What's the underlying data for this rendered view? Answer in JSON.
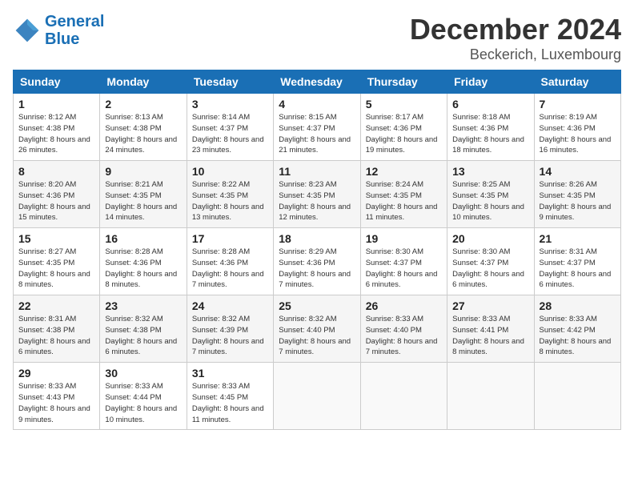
{
  "header": {
    "logo_line1": "General",
    "logo_line2": "Blue",
    "title": "December 2024",
    "subtitle": "Beckerich, Luxembourg"
  },
  "weekdays": [
    "Sunday",
    "Monday",
    "Tuesday",
    "Wednesday",
    "Thursday",
    "Friday",
    "Saturday"
  ],
  "weeks": [
    [
      {
        "day": "1",
        "sunrise": "Sunrise: 8:12 AM",
        "sunset": "Sunset: 4:38 PM",
        "daylight": "Daylight: 8 hours and 26 minutes."
      },
      {
        "day": "2",
        "sunrise": "Sunrise: 8:13 AM",
        "sunset": "Sunset: 4:38 PM",
        "daylight": "Daylight: 8 hours and 24 minutes."
      },
      {
        "day": "3",
        "sunrise": "Sunrise: 8:14 AM",
        "sunset": "Sunset: 4:37 PM",
        "daylight": "Daylight: 8 hours and 23 minutes."
      },
      {
        "day": "4",
        "sunrise": "Sunrise: 8:15 AM",
        "sunset": "Sunset: 4:37 PM",
        "daylight": "Daylight: 8 hours and 21 minutes."
      },
      {
        "day": "5",
        "sunrise": "Sunrise: 8:17 AM",
        "sunset": "Sunset: 4:36 PM",
        "daylight": "Daylight: 8 hours and 19 minutes."
      },
      {
        "day": "6",
        "sunrise": "Sunrise: 8:18 AM",
        "sunset": "Sunset: 4:36 PM",
        "daylight": "Daylight: 8 hours and 18 minutes."
      },
      {
        "day": "7",
        "sunrise": "Sunrise: 8:19 AM",
        "sunset": "Sunset: 4:36 PM",
        "daylight": "Daylight: 8 hours and 16 minutes."
      }
    ],
    [
      {
        "day": "8",
        "sunrise": "Sunrise: 8:20 AM",
        "sunset": "Sunset: 4:36 PM",
        "daylight": "Daylight: 8 hours and 15 minutes."
      },
      {
        "day": "9",
        "sunrise": "Sunrise: 8:21 AM",
        "sunset": "Sunset: 4:35 PM",
        "daylight": "Daylight: 8 hours and 14 minutes."
      },
      {
        "day": "10",
        "sunrise": "Sunrise: 8:22 AM",
        "sunset": "Sunset: 4:35 PM",
        "daylight": "Daylight: 8 hours and 13 minutes."
      },
      {
        "day": "11",
        "sunrise": "Sunrise: 8:23 AM",
        "sunset": "Sunset: 4:35 PM",
        "daylight": "Daylight: 8 hours and 12 minutes."
      },
      {
        "day": "12",
        "sunrise": "Sunrise: 8:24 AM",
        "sunset": "Sunset: 4:35 PM",
        "daylight": "Daylight: 8 hours and 11 minutes."
      },
      {
        "day": "13",
        "sunrise": "Sunrise: 8:25 AM",
        "sunset": "Sunset: 4:35 PM",
        "daylight": "Daylight: 8 hours and 10 minutes."
      },
      {
        "day": "14",
        "sunrise": "Sunrise: 8:26 AM",
        "sunset": "Sunset: 4:35 PM",
        "daylight": "Daylight: 8 hours and 9 minutes."
      }
    ],
    [
      {
        "day": "15",
        "sunrise": "Sunrise: 8:27 AM",
        "sunset": "Sunset: 4:35 PM",
        "daylight": "Daylight: 8 hours and 8 minutes."
      },
      {
        "day": "16",
        "sunrise": "Sunrise: 8:28 AM",
        "sunset": "Sunset: 4:36 PM",
        "daylight": "Daylight: 8 hours and 8 minutes."
      },
      {
        "day": "17",
        "sunrise": "Sunrise: 8:28 AM",
        "sunset": "Sunset: 4:36 PM",
        "daylight": "Daylight: 8 hours and 7 minutes."
      },
      {
        "day": "18",
        "sunrise": "Sunrise: 8:29 AM",
        "sunset": "Sunset: 4:36 PM",
        "daylight": "Daylight: 8 hours and 7 minutes."
      },
      {
        "day": "19",
        "sunrise": "Sunrise: 8:30 AM",
        "sunset": "Sunset: 4:37 PM",
        "daylight": "Daylight: 8 hours and 6 minutes."
      },
      {
        "day": "20",
        "sunrise": "Sunrise: 8:30 AM",
        "sunset": "Sunset: 4:37 PM",
        "daylight": "Daylight: 8 hours and 6 minutes."
      },
      {
        "day": "21",
        "sunrise": "Sunrise: 8:31 AM",
        "sunset": "Sunset: 4:37 PM",
        "daylight": "Daylight: 8 hours and 6 minutes."
      }
    ],
    [
      {
        "day": "22",
        "sunrise": "Sunrise: 8:31 AM",
        "sunset": "Sunset: 4:38 PM",
        "daylight": "Daylight: 8 hours and 6 minutes."
      },
      {
        "day": "23",
        "sunrise": "Sunrise: 8:32 AM",
        "sunset": "Sunset: 4:38 PM",
        "daylight": "Daylight: 8 hours and 6 minutes."
      },
      {
        "day": "24",
        "sunrise": "Sunrise: 8:32 AM",
        "sunset": "Sunset: 4:39 PM",
        "daylight": "Daylight: 8 hours and 7 minutes."
      },
      {
        "day": "25",
        "sunrise": "Sunrise: 8:32 AM",
        "sunset": "Sunset: 4:40 PM",
        "daylight": "Daylight: 8 hours and 7 minutes."
      },
      {
        "day": "26",
        "sunrise": "Sunrise: 8:33 AM",
        "sunset": "Sunset: 4:40 PM",
        "daylight": "Daylight: 8 hours and 7 minutes."
      },
      {
        "day": "27",
        "sunrise": "Sunrise: 8:33 AM",
        "sunset": "Sunset: 4:41 PM",
        "daylight": "Daylight: 8 hours and 8 minutes."
      },
      {
        "day": "28",
        "sunrise": "Sunrise: 8:33 AM",
        "sunset": "Sunset: 4:42 PM",
        "daylight": "Daylight: 8 hours and 8 minutes."
      }
    ],
    [
      {
        "day": "29",
        "sunrise": "Sunrise: 8:33 AM",
        "sunset": "Sunset: 4:43 PM",
        "daylight": "Daylight: 8 hours and 9 minutes."
      },
      {
        "day": "30",
        "sunrise": "Sunrise: 8:33 AM",
        "sunset": "Sunset: 4:44 PM",
        "daylight": "Daylight: 8 hours and 10 minutes."
      },
      {
        "day": "31",
        "sunrise": "Sunrise: 8:33 AM",
        "sunset": "Sunset: 4:45 PM",
        "daylight": "Daylight: 8 hours and 11 minutes."
      },
      null,
      null,
      null,
      null
    ]
  ]
}
